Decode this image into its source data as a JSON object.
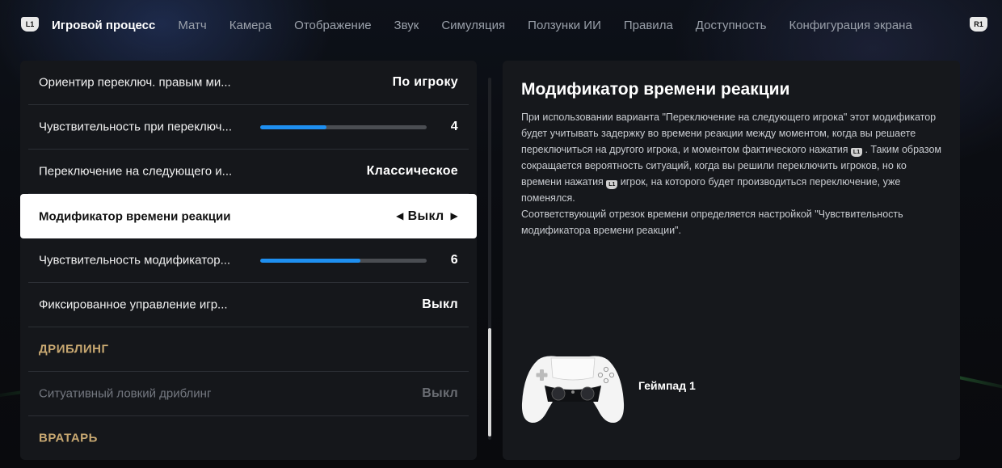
{
  "nav": {
    "left_button": "L1",
    "right_button": "R1",
    "tabs": [
      {
        "label": "Игровой процесс",
        "active": true
      },
      {
        "label": "Матч"
      },
      {
        "label": "Камера"
      },
      {
        "label": "Отображение"
      },
      {
        "label": "Звук"
      },
      {
        "label": "Симуляция"
      },
      {
        "label": "Ползунки ИИ"
      },
      {
        "label": "Правила"
      },
      {
        "label": "Доступность"
      },
      {
        "label": "Конфигурация экрана"
      }
    ]
  },
  "settings": [
    {
      "label": "Ориентир переключ. правым ми...",
      "value": "По игроку"
    },
    {
      "label": "Чувствительность при переключ...",
      "value": "4",
      "slider": 0.4
    },
    {
      "label": "Переключение на следующего и...",
      "value": "Классическое"
    },
    {
      "label": "Модификатор времени реакции",
      "value": "Выкл",
      "selected": true
    },
    {
      "label": "Чувствительность модификатор...",
      "value": "6",
      "slider": 0.6
    },
    {
      "label": "Фиксированное управление игр...",
      "value": "Выкл"
    },
    {
      "label": "ДРИБЛИНГ",
      "section": true
    },
    {
      "label": "Ситуативный ловкий дриблинг",
      "value": "Выкл",
      "disabled": true
    },
    {
      "label": "ВРАТАРЬ",
      "section": true
    }
  ],
  "description": {
    "title": "Модификатор времени реакции",
    "button_glyph": "L1",
    "para1_a": "При использовании варианта \"Переключение на следующего игрока\" этот модификатор будет учитывать задержку во времени реакции между моментом, когда вы решаете переключиться на другого игрока, и моментом фактического нажатия ",
    "para1_b": " . Таким образом сокращается вероятность ситуаций, когда вы решили переключить игроков, но ко времени нажатия ",
    "para1_c": " игрок, на которого будет производиться переключение, уже поменялся.",
    "para2": "Соответствующий отрезок времени определяется настройкой \"Чувствительность модификатора времени реакции\"."
  },
  "controller": {
    "label": "Геймпад 1"
  },
  "colors": {
    "slider_fill": "#1e8ff0",
    "section_header": "#c8a871",
    "selected_row_bg": "#ffffff"
  }
}
